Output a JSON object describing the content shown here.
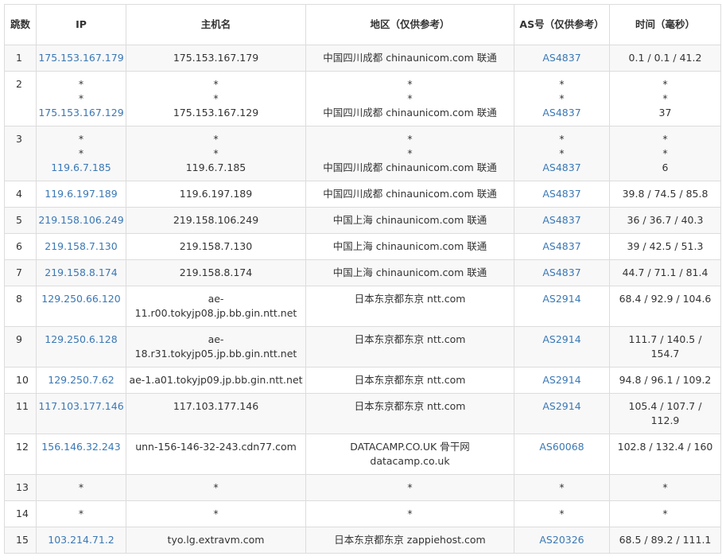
{
  "headers": {
    "hop": "跳数",
    "ip": "IP",
    "host": "主机名",
    "region": "地区（仅供参考）",
    "asn": "AS号（仅供参考）",
    "time": "时间（毫秒）"
  },
  "rows": [
    {
      "hop": "1",
      "ip": [
        "175.153.167.179"
      ],
      "host": [
        "175.153.167.179"
      ],
      "region": [
        "中国四川成都 chinaunicom.com 联通"
      ],
      "asn": [
        "AS4837"
      ],
      "time": [
        "0.1 / 0.1 / 41.2"
      ]
    },
    {
      "hop": "2",
      "ip": [
        "*",
        "*",
        "175.153.167.129"
      ],
      "host": [
        "*",
        "*",
        "175.153.167.129"
      ],
      "region": [
        "*",
        "*",
        "中国四川成都 chinaunicom.com 联通"
      ],
      "asn": [
        "*",
        "*",
        "AS4837"
      ],
      "time": [
        "*",
        "*",
        "37"
      ]
    },
    {
      "hop": "3",
      "ip": [
        "*",
        "*",
        "119.6.7.185"
      ],
      "host": [
        "*",
        "*",
        "119.6.7.185"
      ],
      "region": [
        "*",
        "*",
        "中国四川成都 chinaunicom.com 联通"
      ],
      "asn": [
        "*",
        "*",
        "AS4837"
      ],
      "time": [
        "*",
        "*",
        "6"
      ]
    },
    {
      "hop": "4",
      "ip": [
        "119.6.197.189"
      ],
      "host": [
        "119.6.197.189"
      ],
      "region": [
        "中国四川成都 chinaunicom.com 联通"
      ],
      "asn": [
        "AS4837"
      ],
      "time": [
        "39.8 / 74.5 / 85.8"
      ]
    },
    {
      "hop": "5",
      "ip": [
        "219.158.106.249"
      ],
      "host": [
        "219.158.106.249"
      ],
      "region": [
        "中国上海 chinaunicom.com 联通"
      ],
      "asn": [
        "AS4837"
      ],
      "time": [
        "36 / 36.7 / 40.3"
      ]
    },
    {
      "hop": "6",
      "ip": [
        "219.158.7.130"
      ],
      "host": [
        "219.158.7.130"
      ],
      "region": [
        "中国上海 chinaunicom.com 联通"
      ],
      "asn": [
        "AS4837"
      ],
      "time": [
        "39 / 42.5 / 51.3"
      ]
    },
    {
      "hop": "7",
      "ip": [
        "219.158.8.174"
      ],
      "host": [
        "219.158.8.174"
      ],
      "region": [
        "中国上海 chinaunicom.com 联通"
      ],
      "asn": [
        "AS4837"
      ],
      "time": [
        "44.7 / 71.1 / 81.4"
      ]
    },
    {
      "hop": "8",
      "ip": [
        "129.250.66.120"
      ],
      "host": [
        "ae-",
        "11.r00.tokyjp08.jp.bb.gin.ntt.net"
      ],
      "region": [
        "日本东京都东京 ntt.com"
      ],
      "asn": [
        "AS2914"
      ],
      "time": [
        "68.4 / 92.9 / 104.6"
      ]
    },
    {
      "hop": "9",
      "ip": [
        "129.250.6.128"
      ],
      "host": [
        "ae-",
        "18.r31.tokyjp05.jp.bb.gin.ntt.net"
      ],
      "region": [
        "日本东京都东京 ntt.com"
      ],
      "asn": [
        "AS2914"
      ],
      "time": [
        "111.7 / 140.5 /",
        "154.7"
      ]
    },
    {
      "hop": "10",
      "ip": [
        "129.250.7.62"
      ],
      "host": [
        "ae-1.a01.tokyjp09.jp.bb.gin.ntt.net"
      ],
      "region": [
        "日本东京都东京 ntt.com"
      ],
      "asn": [
        "AS2914"
      ],
      "time": [
        "94.8 / 96.1 / 109.2"
      ]
    },
    {
      "hop": "11",
      "ip": [
        "117.103.177.146"
      ],
      "host": [
        "117.103.177.146"
      ],
      "region": [
        "日本东京都东京 ntt.com"
      ],
      "asn": [
        "AS2914"
      ],
      "time": [
        "105.4 / 107.7 /",
        "112.9"
      ]
    },
    {
      "hop": "12",
      "ip": [
        "156.146.32.243"
      ],
      "host": [
        "unn-156-146-32-243.cdn77.com"
      ],
      "region": [
        "DATACAMP.CO.UK 骨干网",
        "datacamp.co.uk"
      ],
      "asn": [
        "AS60068"
      ],
      "time": [
        "102.8 / 132.4 / 160"
      ]
    },
    {
      "hop": "13",
      "ip": [
        "*"
      ],
      "host": [
        "*"
      ],
      "region": [
        "*"
      ],
      "asn": [
        "*"
      ],
      "time": [
        "*"
      ]
    },
    {
      "hop": "14",
      "ip": [
        "*"
      ],
      "host": [
        "*"
      ],
      "region": [
        "*"
      ],
      "asn": [
        "*"
      ],
      "time": [
        "*"
      ]
    },
    {
      "hop": "15",
      "ip": [
        "103.214.71.2"
      ],
      "host": [
        "tyo.lg.extravm.com"
      ],
      "region": [
        "日本东京都东京 zappiehost.com"
      ],
      "asn": [
        "AS20326"
      ],
      "time": [
        "68.5 / 89.2 / 111.1"
      ]
    }
  ]
}
